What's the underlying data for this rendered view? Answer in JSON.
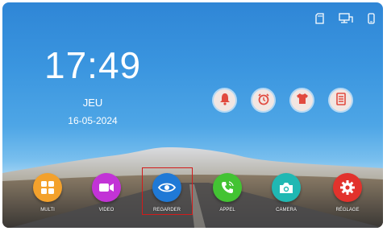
{
  "status_icons": [
    "sd-card-icon",
    "network-icon",
    "phone-icon"
  ],
  "clock": {
    "time": "17:49",
    "day": "JEU",
    "date": "16-05-2024"
  },
  "quick_actions": [
    {
      "name": "bell-button",
      "icon": "bell-icon"
    },
    {
      "name": "alarm-button",
      "icon": "alarm-clock-icon"
    },
    {
      "name": "shirt-button",
      "icon": "shirt-icon"
    },
    {
      "name": "list-button",
      "icon": "list-icon"
    }
  ],
  "apps": [
    {
      "label": "MULTI",
      "color": "#f3a12c",
      "icon": "grid-icon"
    },
    {
      "label": "VIDEO",
      "color": "#c233d6",
      "icon": "video-icon"
    },
    {
      "label": "REGARDER",
      "color": "#1f79d6",
      "icon": "eye-icon"
    },
    {
      "label": "APPEL",
      "color": "#43c333",
      "icon": "phone-call-icon"
    },
    {
      "label": "CAMERA",
      "color": "#20b8b3",
      "icon": "camera-icon"
    },
    {
      "label": "RÉGLAGE",
      "color": "#e2322c",
      "icon": "gear-icon"
    }
  ],
  "selected_app": "REGARDER"
}
